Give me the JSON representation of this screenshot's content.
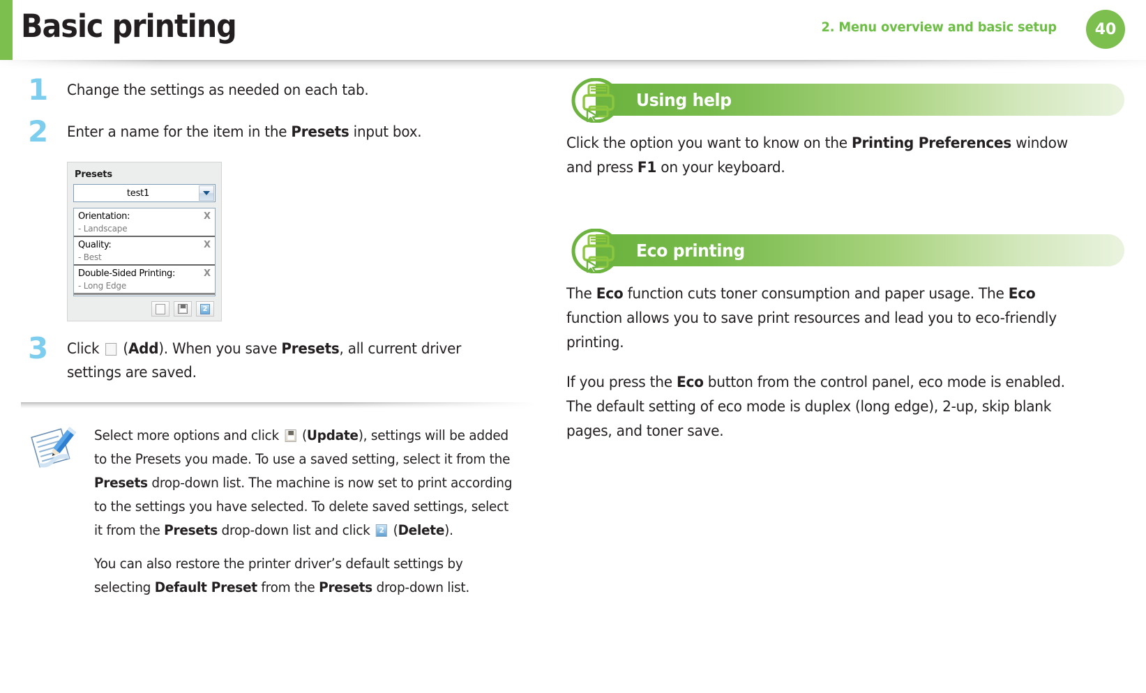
{
  "header": {
    "title": "Basic printing",
    "breadcrumb": "2.  Menu overview and basic setup",
    "page_number": "40",
    "accent_green": "#7dbf4e",
    "accent_blue": "#7ccdee"
  },
  "left_column": {
    "steps": [
      {
        "number": "1",
        "text_html": "Change the settings as needed on each tab."
      },
      {
        "number": "2",
        "text_html": "Enter a name for the item in the <b>Presets</b> input box."
      },
      {
        "number": "3",
        "text_html": "Click <span class=\"inline-icon ic-add\" data-name=\"add-icon\" data-interactable=\"false\"></span> (<b>Add</b>). When you save <b>Presets</b>, all current driver settings are saved."
      }
    ],
    "presets_dialog": {
      "label": "Presets",
      "selected_value": "test1",
      "entries": [
        {
          "key": "Orientation:",
          "value": "- Landscape",
          "remove": "X"
        },
        {
          "key": "Quality:",
          "value": "- Best",
          "remove": "X"
        },
        {
          "key": "Double-Sided Printing:",
          "value": "- Long Edge",
          "remove": "X"
        }
      ],
      "buttons": [
        "add-button",
        "update-button",
        "delete-button"
      ]
    },
    "note": {
      "icon": "note-pencil-icon",
      "paragraphs_html": [
        "Select more options and click <span class=\"inline-icon ic-update\" data-name=\"update-icon\" data-interactable=\"false\"></span> (<b>Update</b>), settings will be added to the Presets you made. To use a saved setting, select it from the <b>Presets</b> drop-down list. The machine is now set to print according to the settings you have selected. To delete saved settings, select it from the <b>Presets</b> drop-down list and click <span class=\"inline-icon ic-delete\" data-name=\"delete-icon\" data-interactable=\"false\"></span> (<b>Delete</b>).",
        "You can also restore the printer driver’s default settings by selecting <b>Default Preset</b> from the <b>Presets</b> drop-down list."
      ]
    }
  },
  "right_column": {
    "sections": [
      {
        "title": "Using help",
        "icon": "printer-cursor-icon",
        "paragraphs_html": [
          "Click the option you want to know on the <b>Printing Preferences</b> window and press <b>F1</b> on your keyboard."
        ]
      },
      {
        "title": "Eco printing",
        "icon": "printer-cursor-icon",
        "paragraphs_html": [
          "The <b>Eco</b> function cuts toner consumption and paper usage. The <b>Eco</b> function allows you to save print resources and lead you to eco-friendly printing.",
          "If you press the <b>Eco</b> button from the control panel, eco mode is enabled. The default setting of eco mode is duplex (long edge), 2-up, skip blank pages, and toner save."
        ]
      }
    ]
  }
}
